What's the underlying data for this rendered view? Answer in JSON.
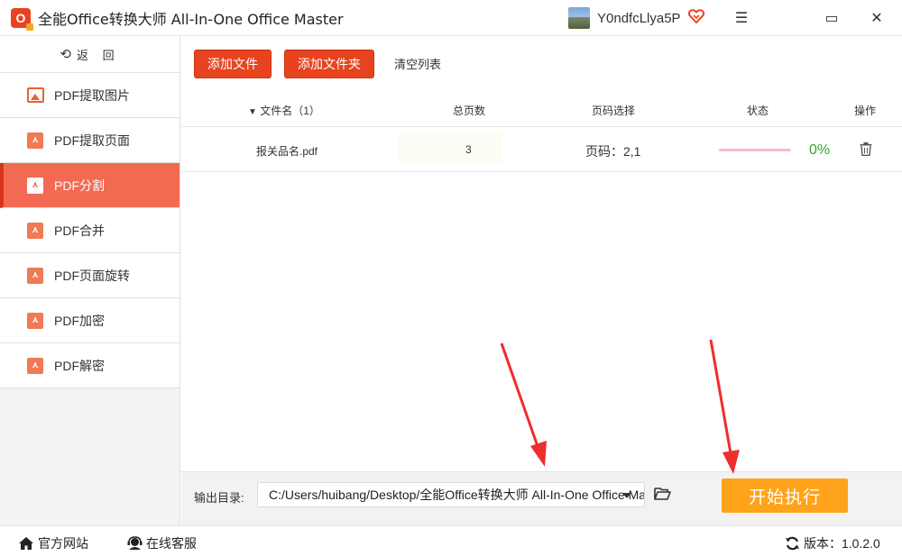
{
  "app": {
    "logo_text": "O",
    "title": "全能Office转换大师 All-In-One Office Master"
  },
  "user": {
    "name": "Y0ndfcLlya5P",
    "vip_icon": "heart-diamond-icon"
  },
  "window_controls": {
    "menu": "☰",
    "maximize": "▭",
    "close": "✕"
  },
  "sidebar": {
    "back_label": "返 回",
    "items": [
      {
        "label": "PDF提取图片",
        "icon": "image-icon",
        "active": false
      },
      {
        "label": "PDF提取页面",
        "icon": "pdf-icon",
        "active": false
      },
      {
        "label": "PDF分割",
        "icon": "pdf-icon",
        "active": true
      },
      {
        "label": "PDF合并",
        "icon": "pdf-icon",
        "active": false
      },
      {
        "label": "PDF页面旋转",
        "icon": "pdf-icon",
        "active": false
      },
      {
        "label": "PDF加密",
        "icon": "pdf-icon",
        "active": false
      },
      {
        "label": "PDF解密",
        "icon": "pdf-icon",
        "active": false
      }
    ]
  },
  "toolbar": {
    "add_file": "添加文件",
    "add_folder": "添加文件夹",
    "clear_list": "清空列表"
  },
  "table": {
    "headers": {
      "filename": "文件名（1）",
      "total_pages": "总页数",
      "page_select": "页码选择",
      "status": "状态",
      "actions": "操作"
    },
    "rows": [
      {
        "filename": "报关品名.pdf",
        "total_pages": "3",
        "page_select": "页码：2,1",
        "progress_pct": 0,
        "status": "0%"
      }
    ]
  },
  "output": {
    "label": "输出目录:",
    "path": "C:/Users/huibang/Desktop/全能Office转换大师 All-In-One Office Master"
  },
  "start_button": "开始执行",
  "statusbar": {
    "website": "官方网站",
    "support": "在线客服",
    "version": "版本：1.0.2.0"
  },
  "colors": {
    "accent": "#e8431f",
    "active_nav": "#f36a52",
    "start": "#ffa31a",
    "progress_text": "#2fa533"
  }
}
